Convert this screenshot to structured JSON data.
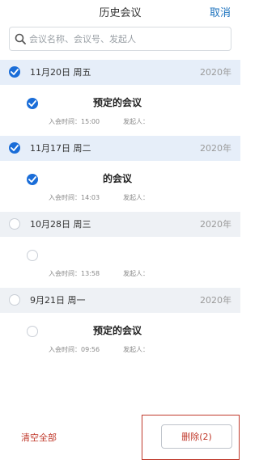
{
  "header": {
    "title": "历史会议",
    "cancel_label": "取消"
  },
  "search": {
    "placeholder": "会议名称、会议号、发起人",
    "icon": "search-icon"
  },
  "days": [
    {
      "label": "11月20日 周五",
      "year": "2020年",
      "checked": true,
      "meetings": [
        {
          "name": "预定的会议",
          "time": "入会时间：15:00",
          "host": "发起人：",
          "checked": true
        }
      ]
    },
    {
      "label": "11月17日 周二",
      "year": "2020年",
      "checked": true,
      "meetings": [
        {
          "name": "的会议",
          "time": "入会时间：14:03",
          "host": "发起人：",
          "checked": true
        }
      ]
    },
    {
      "label": "10月28日 周三",
      "year": "2020年",
      "checked": false,
      "meetings": [
        {
          "name": "",
          "time": "入会时间：13:58",
          "host": "发起人：",
          "checked": false
        }
      ]
    },
    {
      "label": "9月21日 周一",
      "year": "2020年",
      "checked": false,
      "meetings": [
        {
          "name": "预定的会议",
          "time": "入会时间：09:56",
          "host": "发起人：",
          "checked": false
        }
      ]
    }
  ],
  "footer": {
    "clear_label": "清空全部",
    "delete_label": "删除(2)"
  },
  "colors": {
    "accent": "#1a6dd8",
    "danger": "#c0392b",
    "day_bg": "#eef1f5",
    "day_bg_selected": "#e6eef9"
  }
}
